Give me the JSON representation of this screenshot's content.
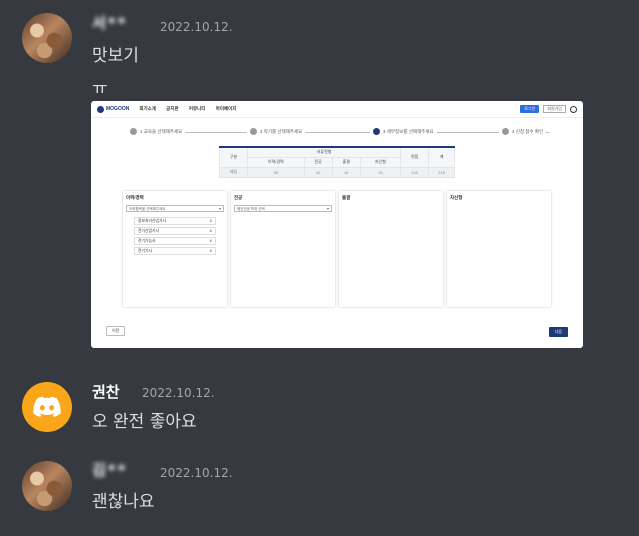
{
  "messages": [
    {
      "username": "서**",
      "timestamp": "2022.10.12.",
      "lines": [
        "맛보기",
        "ㅠ"
      ]
    },
    {
      "username": "권찬",
      "timestamp": "2022.10.12.",
      "lines": [
        "오 완전 좋아요"
      ]
    },
    {
      "username": "김**",
      "timestamp": "2022.10.12.",
      "lines": [
        "괜찮나요"
      ]
    }
  ],
  "screenshot": {
    "logo": "MOGOON",
    "menu": [
      "회기소개",
      "공지판",
      "커뮤니티",
      "마이페이지"
    ],
    "btn_primary": "로그인",
    "btn_secondary": "회원가입",
    "steps": [
      "1  교육을 선택해주세요",
      "2  학기를 선택해주세요",
      "3  세부정보를 선택해주세요",
      "4  신청 접수 확인"
    ],
    "table": {
      "header_group": "서류전형",
      "row_label_head": "구분",
      "cols": [
        "이력/경력",
        "전공",
        "출결",
        "자산형",
        "면접",
        "계"
      ],
      "row_label_val": "배점",
      "values": [
        "50",
        "40",
        "10",
        "15",
        "100",
        "215"
      ]
    },
    "boxes": [
      {
        "title": "이력/경력",
        "select": "이력항목을 선택해주세요",
        "items": [
          "정보처리산업기사",
          "전기산업기사",
          "전기기능사",
          "전기기사"
        ]
      },
      {
        "title": "전공",
        "select": "해당전공 학과 선택",
        "items": []
      },
      {
        "title": "출결",
        "select": "",
        "items": []
      },
      {
        "title": "자산형",
        "select": "",
        "items": []
      }
    ],
    "prev": "이전",
    "next": "다음"
  },
  "colors": {
    "background": "#36393f",
    "username": "#ffffff",
    "timestamp": "#a3a6aa",
    "discord_avatar": "#faa61a"
  }
}
